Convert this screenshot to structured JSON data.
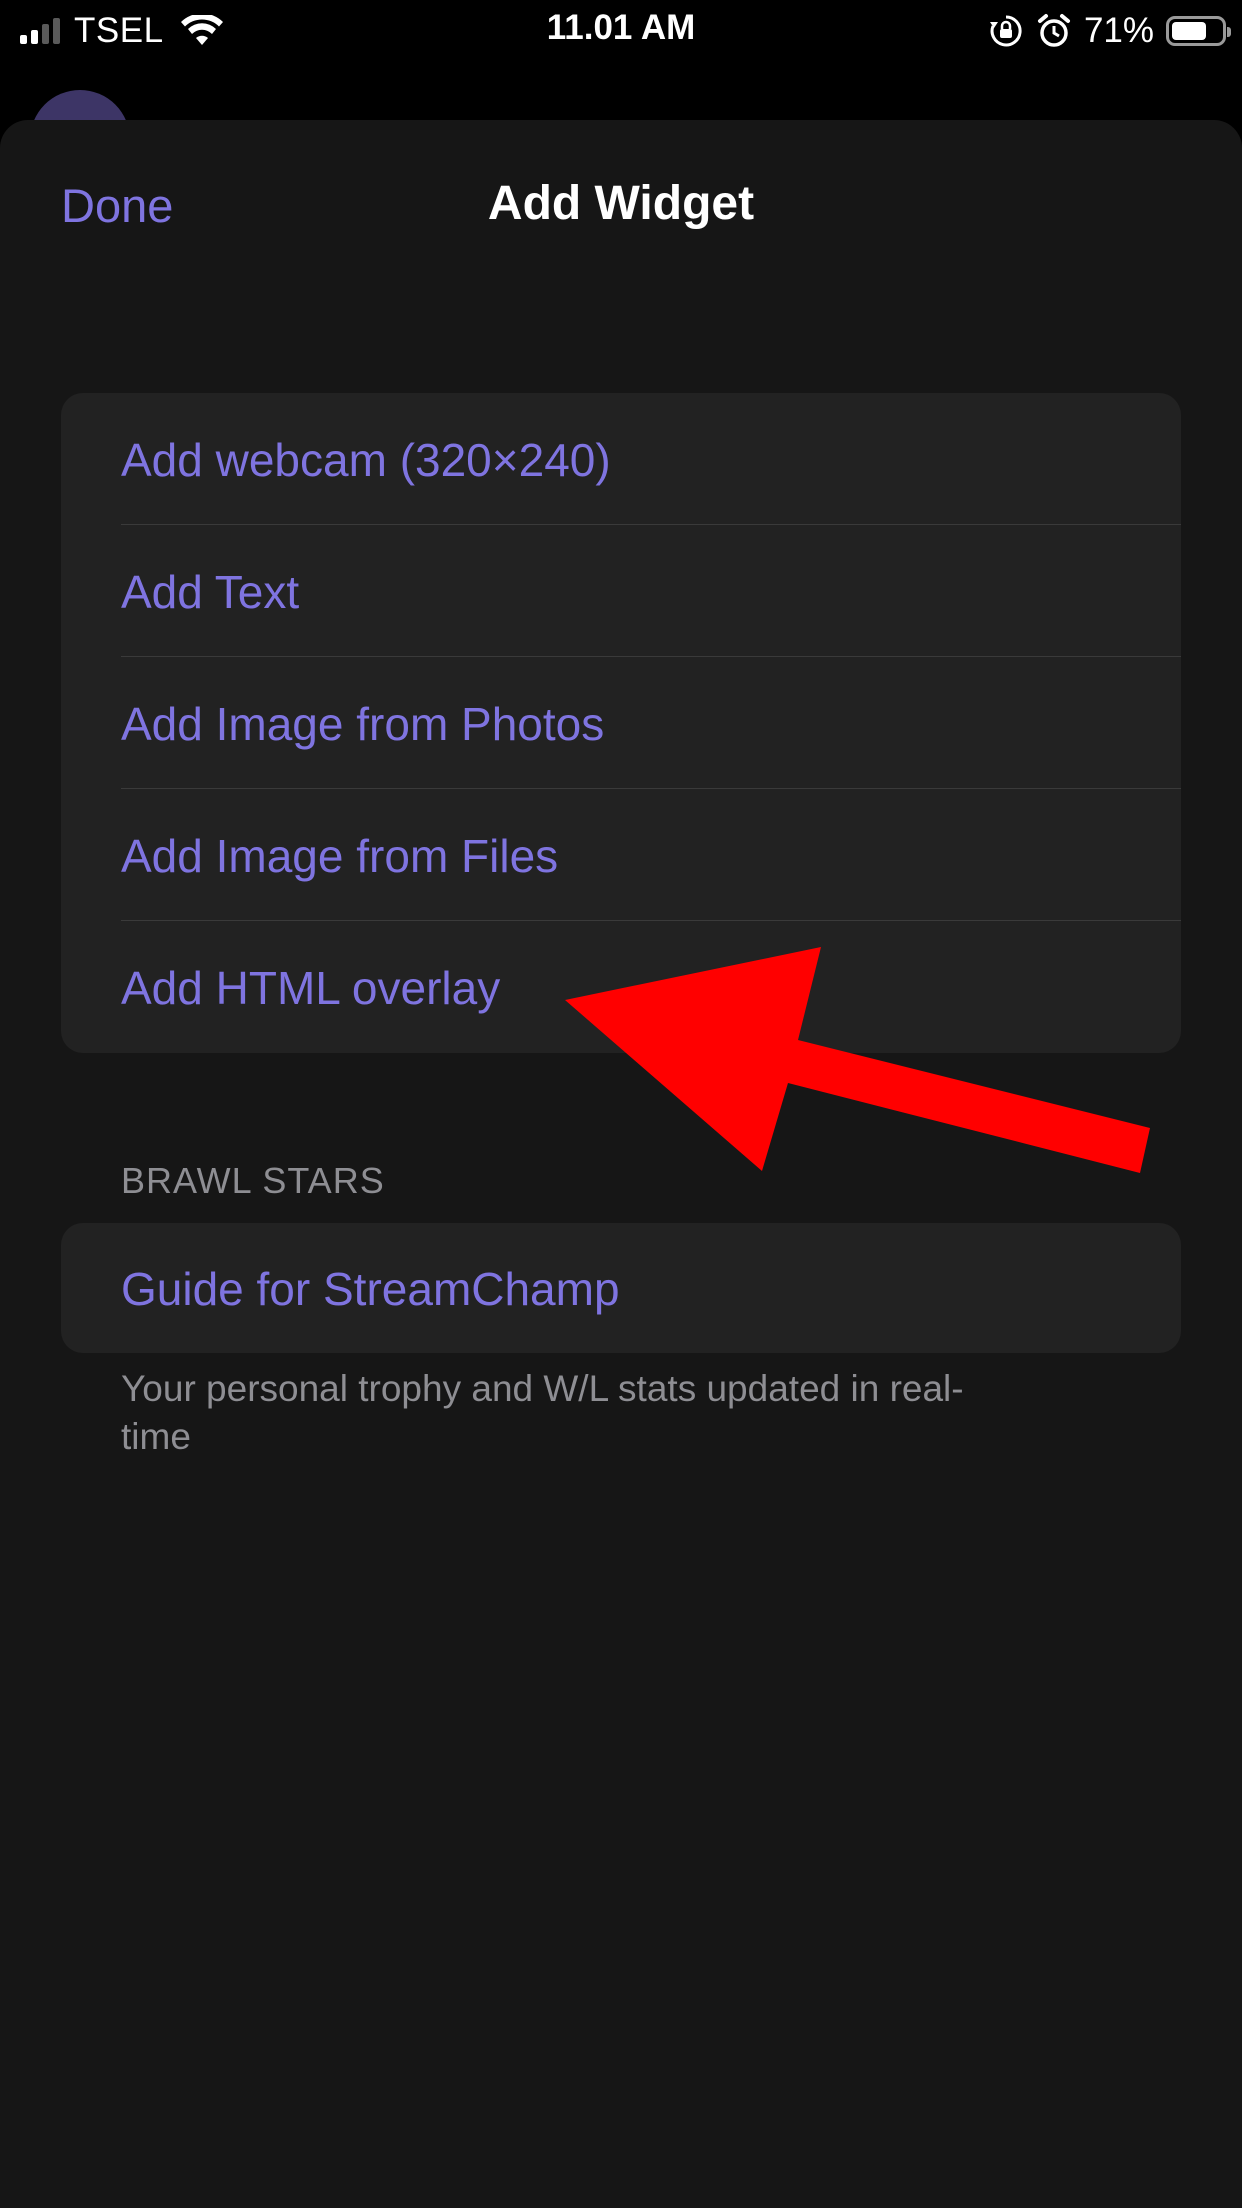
{
  "status_bar": {
    "carrier": "TSEL",
    "time": "11.01 AM",
    "battery_percent": "71%",
    "battery_level": 0.71,
    "signal_bars_active": 2,
    "icons": [
      "signal-icon",
      "wifi-icon",
      "rotation-lock-icon",
      "alarm-icon",
      "battery-icon"
    ]
  },
  "sheet": {
    "title": "Add Widget",
    "done_label": "Done",
    "accent_color": "#7f74e0"
  },
  "widget_options": [
    {
      "label": "Add webcam (320×240)"
    },
    {
      "label": "Add Text"
    },
    {
      "label": "Add Image from Photos"
    },
    {
      "label": "Add Image from Files"
    },
    {
      "label": "Add HTML overlay"
    }
  ],
  "brawl_section": {
    "header": "BRAWL STARS",
    "item_label": "Guide for StreamChamp",
    "footer": "Your personal trophy and W/L stats updated in real-time"
  },
  "annotation": {
    "type": "arrow",
    "color": "#ff0000",
    "points_to": "Add HTML overlay"
  }
}
